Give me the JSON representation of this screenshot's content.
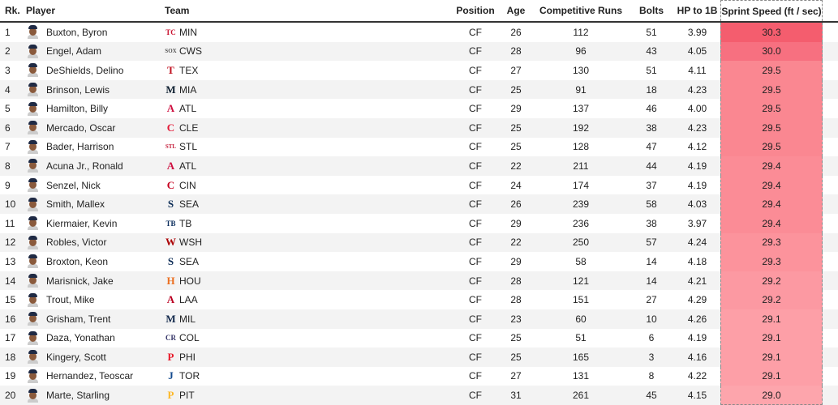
{
  "headers": {
    "rank": "Rk.",
    "player": "Player",
    "team": "Team",
    "position": "Position",
    "age": "Age",
    "runs": "Competitive Runs",
    "bolts": "Bolts",
    "hp": "HP to 1B",
    "speed": "Sprint Speed (ft / sec)"
  },
  "rows": [
    {
      "rank": "1",
      "player": "Buxton, Byron",
      "team": "MIN",
      "team_logo": "TC",
      "logo_color": "#c8102e",
      "position": "CF",
      "age": "26",
      "runs": "112",
      "bolts": "51",
      "hp": "3.99",
      "speed": "30.3",
      "speed_color": "#f45d6e"
    },
    {
      "rank": "2",
      "player": "Engel, Adam",
      "team": "CWS",
      "team_logo": "SOX",
      "logo_color": "#555555",
      "position": "CF",
      "age": "28",
      "runs": "96",
      "bolts": "43",
      "hp": "4.05",
      "speed": "30.0",
      "speed_color": "#f77080"
    },
    {
      "rank": "3",
      "player": "DeShields, Delino",
      "team": "TEX",
      "team_logo": "T",
      "logo_color": "#c0111f",
      "position": "CF",
      "age": "27",
      "runs": "130",
      "bolts": "51",
      "hp": "4.11",
      "speed": "29.5",
      "speed_color": "#fa8791"
    },
    {
      "rank": "4",
      "player": "Brinson, Lewis",
      "team": "MIA",
      "team_logo": "M",
      "logo_color": "#0d1e2f",
      "position": "CF",
      "age": "25",
      "runs": "91",
      "bolts": "18",
      "hp": "4.23",
      "speed": "29.5",
      "speed_color": "#fa8791"
    },
    {
      "rank": "5",
      "player": "Hamilton, Billy",
      "team": "ATL",
      "team_logo": "A",
      "logo_color": "#ce1141",
      "position": "CF",
      "age": "29",
      "runs": "137",
      "bolts": "46",
      "hp": "4.00",
      "speed": "29.5",
      "speed_color": "#fa8791"
    },
    {
      "rank": "6",
      "player": "Mercado, Oscar",
      "team": "CLE",
      "team_logo": "C",
      "logo_color": "#e31937",
      "position": "CF",
      "age": "25",
      "runs": "192",
      "bolts": "38",
      "hp": "4.23",
      "speed": "29.5",
      "speed_color": "#fa8791"
    },
    {
      "rank": "7",
      "player": "Bader, Harrison",
      "team": "STL",
      "team_logo": "STL",
      "logo_color": "#c41e3a",
      "position": "CF",
      "age": "25",
      "runs": "128",
      "bolts": "47",
      "hp": "4.12",
      "speed": "29.5",
      "speed_color": "#fa8791"
    },
    {
      "rank": "8",
      "player": "Acuna Jr., Ronald",
      "team": "ATL",
      "team_logo": "A",
      "logo_color": "#ce1141",
      "position": "CF",
      "age": "22",
      "runs": "211",
      "bolts": "44",
      "hp": "4.19",
      "speed": "29.4",
      "speed_color": "#fb8c96"
    },
    {
      "rank": "9",
      "player": "Senzel, Nick",
      "team": "CIN",
      "team_logo": "C",
      "logo_color": "#c6011f",
      "position": "CF",
      "age": "24",
      "runs": "174",
      "bolts": "37",
      "hp": "4.19",
      "speed": "29.4",
      "speed_color": "#fb8c96"
    },
    {
      "rank": "10",
      "player": "Smith, Mallex",
      "team": "SEA",
      "team_logo": "S",
      "logo_color": "#0c2c56",
      "position": "CF",
      "age": "26",
      "runs": "239",
      "bolts": "58",
      "hp": "4.03",
      "speed": "29.4",
      "speed_color": "#fb8c96"
    },
    {
      "rank": "11",
      "player": "Kiermaier, Kevin",
      "team": "TB",
      "team_logo": "TB",
      "logo_color": "#092c5c",
      "position": "CF",
      "age": "29",
      "runs": "236",
      "bolts": "38",
      "hp": "3.97",
      "speed": "29.4",
      "speed_color": "#fb8c96"
    },
    {
      "rank": "12",
      "player": "Robles, Victor",
      "team": "WSH",
      "team_logo": "W",
      "logo_color": "#ab0003",
      "position": "CF",
      "age": "22",
      "runs": "250",
      "bolts": "57",
      "hp": "4.24",
      "speed": "29.3",
      "speed_color": "#fc939c"
    },
    {
      "rank": "13",
      "player": "Broxton, Keon",
      "team": "SEA",
      "team_logo": "S",
      "logo_color": "#0c2c56",
      "position": "CF",
      "age": "29",
      "runs": "58",
      "bolts": "14",
      "hp": "4.18",
      "speed": "29.3",
      "speed_color": "#fc939c"
    },
    {
      "rank": "14",
      "player": "Marisnick, Jake",
      "team": "HOU",
      "team_logo": "H",
      "logo_color": "#eb6e1f",
      "position": "CF",
      "age": "28",
      "runs": "121",
      "bolts": "14",
      "hp": "4.21",
      "speed": "29.2",
      "speed_color": "#fc99a2"
    },
    {
      "rank": "15",
      "player": "Trout, Mike",
      "team": "LAA",
      "team_logo": "A",
      "logo_color": "#ba0021",
      "position": "CF",
      "age": "28",
      "runs": "151",
      "bolts": "27",
      "hp": "4.29",
      "speed": "29.2",
      "speed_color": "#fc99a2"
    },
    {
      "rank": "16",
      "player": "Grisham, Trent",
      "team": "MIL",
      "team_logo": "M",
      "logo_color": "#12284b",
      "position": "CF",
      "age": "23",
      "runs": "60",
      "bolts": "10",
      "hp": "4.26",
      "speed": "29.1",
      "speed_color": "#fd9fa7"
    },
    {
      "rank": "17",
      "player": "Daza, Yonathan",
      "team": "COL",
      "team_logo": "CR",
      "logo_color": "#333366",
      "position": "CF",
      "age": "25",
      "runs": "51",
      "bolts": "6",
      "hp": "4.19",
      "speed": "29.1",
      "speed_color": "#fd9fa7"
    },
    {
      "rank": "18",
      "player": "Kingery, Scott",
      "team": "PHI",
      "team_logo": "P",
      "logo_color": "#e81828",
      "position": "CF",
      "age": "25",
      "runs": "165",
      "bolts": "3",
      "hp": "4.16",
      "speed": "29.1",
      "speed_color": "#fd9fa7"
    },
    {
      "rank": "19",
      "player": "Hernandez, Teoscar",
      "team": "TOR",
      "team_logo": "J",
      "logo_color": "#134a8e",
      "position": "CF",
      "age": "27",
      "runs": "131",
      "bolts": "8",
      "hp": "4.22",
      "speed": "29.1",
      "speed_color": "#fd9fa7"
    },
    {
      "rank": "20",
      "player": "Marte, Starling",
      "team": "PIT",
      "team_logo": "P",
      "logo_color": "#fdb827",
      "position": "CF",
      "age": "31",
      "runs": "261",
      "bolts": "45",
      "hp": "4.15",
      "speed": "29.0",
      "speed_color": "#fda5ac"
    }
  ]
}
